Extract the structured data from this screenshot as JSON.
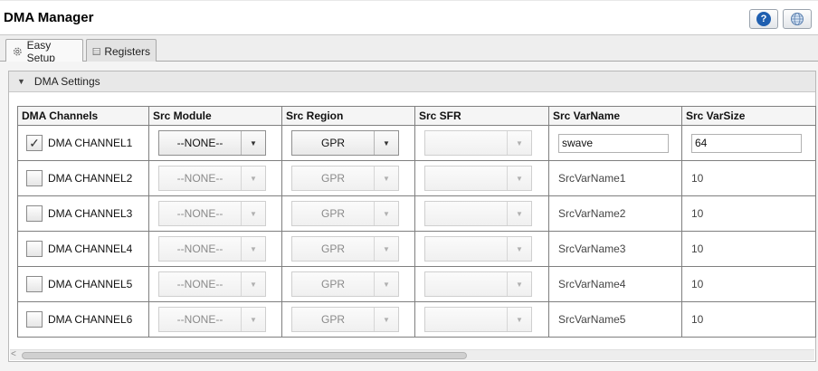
{
  "window": {
    "title": "DMA Manager"
  },
  "toolbar": {
    "help_icon": "help-icon",
    "globe_icon": "globe-icon"
  },
  "tabs": [
    {
      "label": "Easy Setup",
      "icon": "gear-icon",
      "active": true
    },
    {
      "label": "Registers",
      "icon": "register-table-icon",
      "active": false
    }
  ],
  "section": {
    "label": "DMA Settings",
    "expanded": true
  },
  "grid": {
    "columns": [
      "DMA Channels",
      "Src Module",
      "Src Region",
      "Src SFR",
      "Src VarName",
      "Src VarSize"
    ],
    "rows": [
      {
        "channel": "DMA CHANNEL1",
        "checked": true,
        "src_module": "--NONE--",
        "src_region": "GPR",
        "src_sfr": "",
        "src_varname": "swave",
        "src_varsize": "64",
        "editable": true
      },
      {
        "channel": "DMA CHANNEL2",
        "checked": false,
        "src_module": "--NONE--",
        "src_region": "GPR",
        "src_sfr": "",
        "src_varname": "SrcVarName1",
        "src_varsize": "10",
        "editable": false
      },
      {
        "channel": "DMA CHANNEL3",
        "checked": false,
        "src_module": "--NONE--",
        "src_region": "GPR",
        "src_sfr": "",
        "src_varname": "SrcVarName2",
        "src_varsize": "10",
        "editable": false
      },
      {
        "channel": "DMA CHANNEL4",
        "checked": false,
        "src_module": "--NONE--",
        "src_region": "GPR",
        "src_sfr": "",
        "src_varname": "SrcVarName3",
        "src_varsize": "10",
        "editable": false
      },
      {
        "channel": "DMA CHANNEL5",
        "checked": false,
        "src_module": "--NONE--",
        "src_region": "GPR",
        "src_sfr": "",
        "src_varname": "SrcVarName4",
        "src_varsize": "10",
        "editable": false
      },
      {
        "channel": "DMA CHANNEL6",
        "checked": false,
        "src_module": "--NONE--",
        "src_region": "GPR",
        "src_sfr": "",
        "src_varname": "SrcVarName5",
        "src_varsize": "10",
        "editable": false
      }
    ]
  },
  "colors": {
    "help_blue": "#1f5fb0",
    "grid_border": "#7f7f7f",
    "header_bg": "#e8e8e8"
  }
}
